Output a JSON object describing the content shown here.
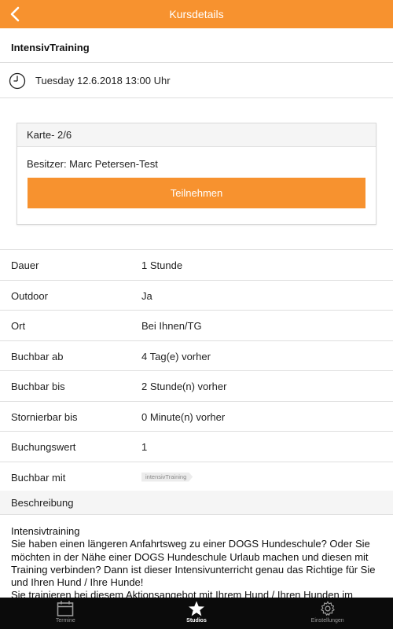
{
  "header": {
    "title": "Kursdetails"
  },
  "course": {
    "name": "IntensivTraining",
    "datetime": "Tuesday 12.6.2018 13:00 Uhr"
  },
  "card": {
    "header": "Karte- 2/6",
    "owner": "Besitzer: Marc Petersen-Test",
    "button_label": "Teilnehmen"
  },
  "details": [
    {
      "key": "Dauer",
      "value": "1 Stunde"
    },
    {
      "key": "Outdoor",
      "value": "Ja"
    },
    {
      "key": "Ort",
      "value": "Bei Ihnen/TG"
    },
    {
      "key": "Buchbar ab",
      "value": "4 Tag(e) vorher"
    },
    {
      "key": "Buchbar bis",
      "value": "2 Stunde(n) vorher"
    },
    {
      "key": "Stornierbar bis",
      "value": "0 Minute(n) vorher"
    },
    {
      "key": "Buchungswert",
      "value": "1"
    },
    {
      "key": "Buchbar mit",
      "tag": "intensivTraining"
    }
  ],
  "description": {
    "heading": "Beschreibung",
    "title": "Intensivtraining",
    "text": "Sie haben einen längeren Anfahrtsweg zu einer DOGS Hundeschule? Oder Sie möchten in der Nähe einer DOGS Hundeschule Urlaub machen und diesen mit Training verbinden? Dann ist dieser Intensivunterricht genau das Richtige für Sie und Ihren Hund / Ihre Hunde!",
    "text_cut": "Sie trainieren bei diesem Aktionsangebot mit Ihrem Hund / Ihren Hunden im"
  },
  "tabbar": {
    "tabs": [
      {
        "label": "Termine",
        "icon": "calendar-icon",
        "active": false
      },
      {
        "label": "Studios",
        "icon": "star-icon",
        "active": true
      },
      {
        "label": "Einstellungen",
        "icon": "gear-icon",
        "active": false
      }
    ]
  },
  "colors": {
    "accent": "#F7922F",
    "tabbar": "#0b0b0b"
  }
}
